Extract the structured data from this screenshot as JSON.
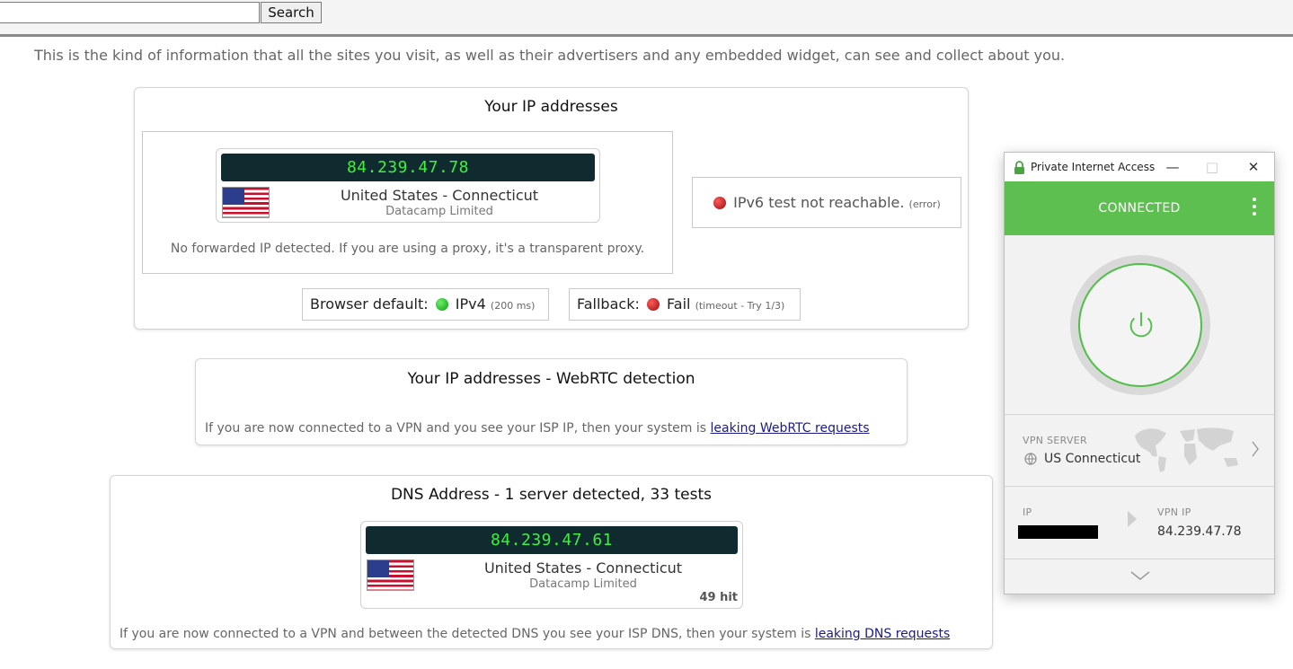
{
  "search": {
    "value": "",
    "button_label": "Search"
  },
  "intro_text": "This is the kind of information that all the sites you visit, as well as their advertisers and any embedded widget, can see and collect about you.",
  "ip_section": {
    "title": "Your IP addresses",
    "ip": "84.239.47.78",
    "location": "United States - Connecticut",
    "isp": "Datacamp Limited",
    "forwarded_note": "No forwarded IP detected. If you are using a proxy, it's a transparent proxy.",
    "ipv6_text": "IPv6 test not reachable.",
    "ipv6_error": "(error)",
    "browser_default_label": "Browser default:",
    "browser_default_value": "IPv4",
    "browser_default_time": "(200 ms)",
    "fallback_label": "Fallback:",
    "fallback_value": "Fail",
    "fallback_detail": "(timeout - Try 1/3)"
  },
  "webrtc_section": {
    "title": "Your IP addresses - WebRTC detection",
    "note": "If you are now connected to a VPN and you see your ISP IP, then your system is",
    "link": "leaking WebRTC requests"
  },
  "dns_section": {
    "title": "DNS Address - 1 server detected, 33 tests",
    "ip": "84.239.47.61",
    "location": "United States - Connecticut",
    "isp": "Datacamp Limited",
    "hits": "49 hit",
    "note": "If you are now connected to a VPN and between the detected DNS you see your ISP DNS, then your system is",
    "link": "leaking DNS requests"
  },
  "pia": {
    "window_title": "Private Internet Access",
    "status": "CONNECTED",
    "vpn_server_label": "VPN SERVER",
    "vpn_server_value": "US Connecticut",
    "ip_label": "IP",
    "vpn_ip_label": "VPN IP",
    "vpn_ip_value": "84.239.47.78",
    "accent_color": "#5cbf4f"
  }
}
